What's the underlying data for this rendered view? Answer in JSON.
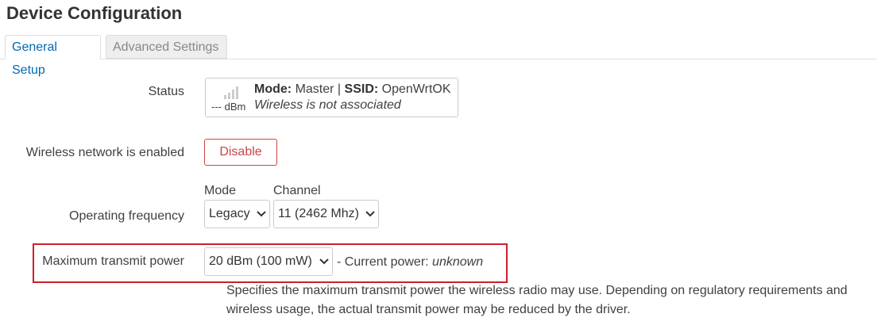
{
  "page": {
    "title": "Device Configuration"
  },
  "tabs": [
    {
      "label": "General Setup",
      "active": true
    },
    {
      "label": "Advanced Settings",
      "active": false
    }
  ],
  "status": {
    "label": "Status",
    "signal_icon": "signal-strength-icon",
    "dbm": "--- dBm",
    "mode_key": "Mode:",
    "mode_value": "Master",
    "separator": "|",
    "ssid_key": "SSID:",
    "ssid_value": "OpenWrtOK",
    "association": "Wireless is not associated"
  },
  "wireless_enabled": {
    "label": "Wireless network is enabled",
    "button_label": "Disable",
    "button_color": "#cc4444"
  },
  "operating_frequency": {
    "label": "Operating frequency",
    "mode_label": "Mode",
    "mode_value": "Legacy",
    "channel_label": "Channel",
    "channel_value": "11 (2462 Mhz)"
  },
  "transmit_power": {
    "label": "Maximum transmit power",
    "value": "20 dBm (100 mW)",
    "current_prefix": "- Current power:",
    "current_value": "unknown",
    "description": "Specifies the maximum transmit power the wireless radio may use. Depending on regulatory requirements and wireless usage, the actual transmit power may be reduced by the driver.",
    "highlight_color": "#cc1f2a"
  },
  "colors": {
    "accent": "#0069b4",
    "text": "#404040"
  }
}
